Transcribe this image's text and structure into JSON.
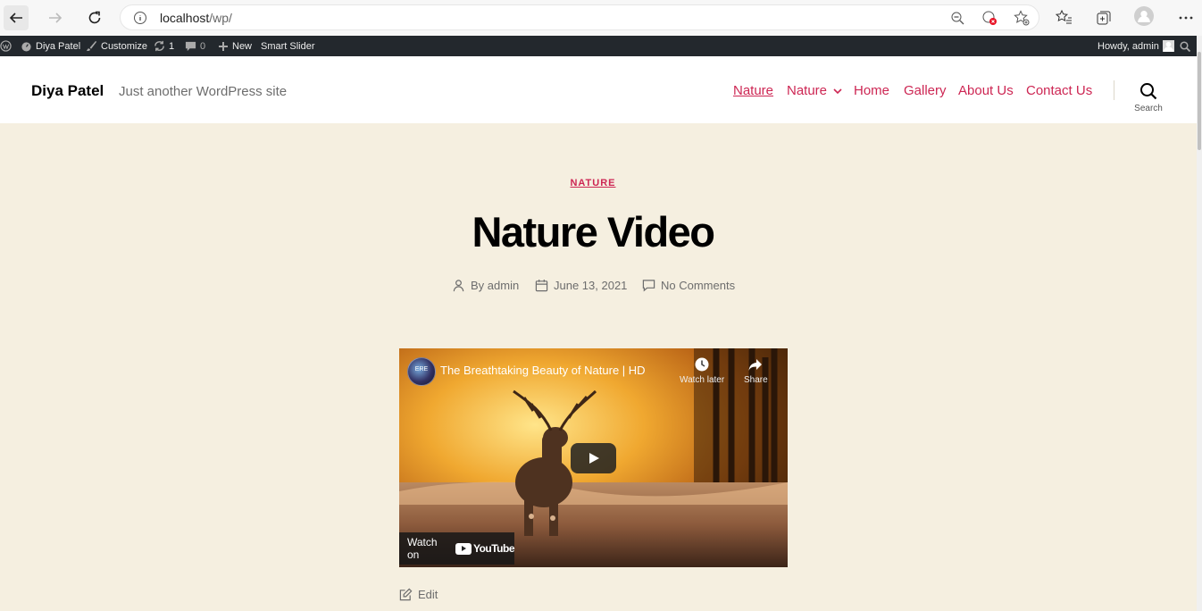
{
  "browser": {
    "url_host": "localhost",
    "url_path": "/wp/"
  },
  "admin_bar": {
    "site_name": "Diya Patel",
    "customize": "Customize",
    "updates_count": "1",
    "comments_count": "0",
    "new_label": "New",
    "smart_slider": "Smart Slider",
    "howdy": "Howdy, admin"
  },
  "site": {
    "title": "Diya Patel",
    "tagline": "Just another WordPress site"
  },
  "menu": {
    "items": [
      "Nature",
      "Nature",
      "Home",
      "Gallery",
      "About Us",
      "Contact Us"
    ],
    "search_label": "Search"
  },
  "post": {
    "category": "NATURE",
    "title": "Nature Video",
    "author": "By admin",
    "date": "June 13, 2021",
    "comments": "No Comments",
    "edit": "Edit"
  },
  "video": {
    "title": "The Breathtaking Beauty of Nature | HD",
    "watch_later": "Watch later",
    "share": "Share",
    "watch_on": "Watch on",
    "youtube": "YouTube",
    "channel_initials": "ERE"
  },
  "colors": {
    "accent": "#cd2653",
    "background": "#f5efe0",
    "admin_bar": "#23282d"
  }
}
